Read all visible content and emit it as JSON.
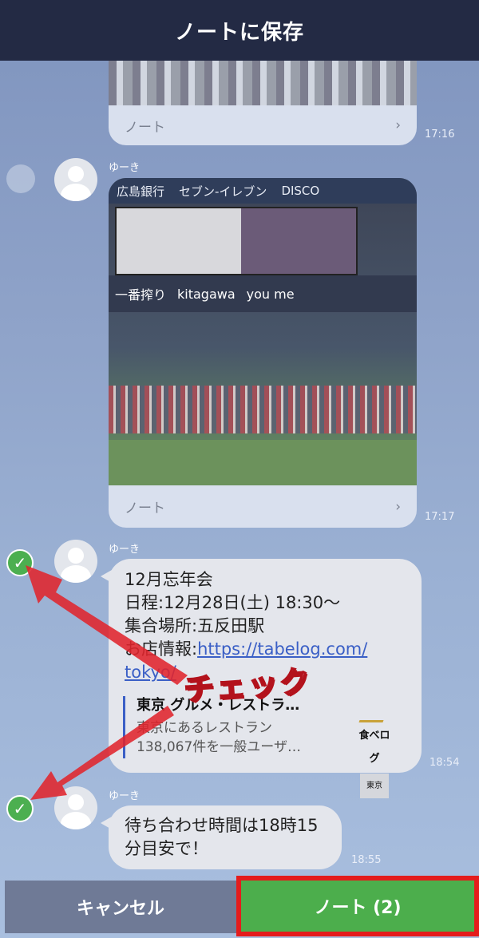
{
  "header": {
    "title": "ノートに保存"
  },
  "messages": {
    "first": {
      "note_label": "ノート",
      "time": "17:16",
      "chevron": "›"
    },
    "photo": {
      "sender": "ゆーき",
      "note_label": "ノート",
      "time": "17:17",
      "chevron": "›",
      "ads": [
        "広島銀行",
        "セブン-イレブン",
        "DISCO"
      ],
      "signs": [
        "一番搾り",
        "kitagawa",
        "you me"
      ]
    },
    "event": {
      "sender": "ゆーき",
      "lines": [
        "12月忘年会",
        "日程:12月28日(土) 18:30〜",
        "集合場所:五反田駅"
      ],
      "shop_prefix": "お店情報:",
      "link_line1": "https://tabelog.com/",
      "link_line2": "tokyo/",
      "card_title": "東京 グルメ・レストラ…",
      "card_desc_1": "東京にあるレストラン",
      "card_desc_2": "138,067件を一般ユーザ…",
      "logo_brand": "食べログ",
      "logo_tag": "東京",
      "time": "18:54",
      "checked": true
    },
    "meet": {
      "sender": "ゆーき",
      "line1": "待ち合わせ時間は18時15",
      "line2": "分目安で！",
      "time": "18:55",
      "checked": true
    }
  },
  "annotation": {
    "callout": "チェック",
    "arrow_color": "#e0242c"
  },
  "footer": {
    "cancel_label": "キャンセル",
    "note_label": "ノート (2)"
  },
  "colors": {
    "header": "#232a44",
    "check": "#4caf50",
    "note_button": "#4cae4c",
    "highlight": "#e41c1c"
  }
}
